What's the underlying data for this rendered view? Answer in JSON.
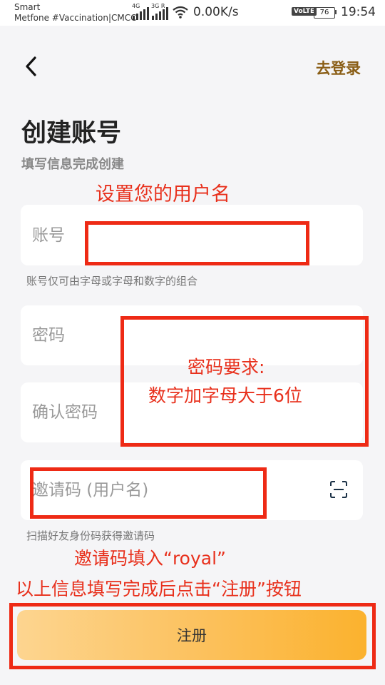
{
  "status_bar": {
    "carrier_line1": "Smart",
    "carrier_line2": "Metfone #Vaccination|CMCC",
    "net1": "4G",
    "net2": "3G R",
    "speed": "0.00K/s",
    "volte": "VoLTE",
    "battery": "76",
    "battery_level": 0.76,
    "time": "19:54"
  },
  "header": {
    "back_icon": "chevron-left-icon",
    "login_link": "去登录"
  },
  "page": {
    "title": "创建账号",
    "subtitle": "填写信息完成创建"
  },
  "form": {
    "account": {
      "placeholder": "账号",
      "value": "",
      "hint": "账号仅可由字母或字母和数字的组合"
    },
    "password": {
      "placeholder": "密码",
      "value": ""
    },
    "confirm_password": {
      "placeholder": "确认密码",
      "value": ""
    },
    "invite_code": {
      "placeholder": "邀请码 (用户名)",
      "value": "",
      "hint": "扫描好友身份码获得邀请码",
      "scan_icon": "scan-icon"
    }
  },
  "register_button": {
    "label": "注册"
  },
  "annotations": {
    "username": "设置您的用户名",
    "password_req_line1": "密码要求:",
    "password_req_line2": "数字加字母大于6位",
    "invite": "邀请码填入“royal”",
    "after": "以上信息填写完成后点击“注册”按钮",
    "color": "#e8301c"
  },
  "colors": {
    "accent": "#8a5e16",
    "button_gradient_start": "#fdd590",
    "button_gradient_end": "#fbb22e",
    "background": "#f5f5f7"
  }
}
